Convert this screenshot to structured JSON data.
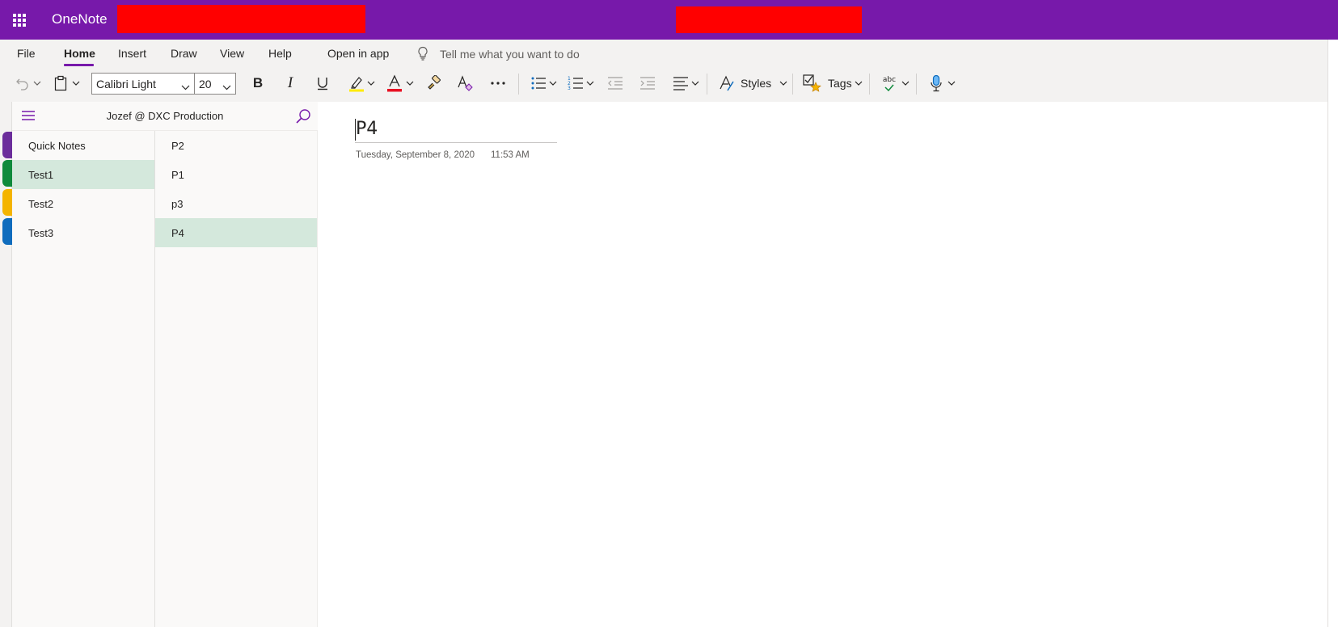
{
  "colors": {
    "brand": "#7719aa",
    "redaction": "#ff0000",
    "selected_background": "#d4e8dc",
    "section_tabs": [
      "#6b2d9b",
      "#0f8a3c",
      "#f4b400",
      "#0f6cbd"
    ]
  },
  "app": {
    "title": "OneNote",
    "launcher_icon": "waffle-grid-icon"
  },
  "ribbon": {
    "tabs": [
      {
        "label": "File"
      },
      {
        "label": "Home",
        "active": true
      },
      {
        "label": "Insert"
      },
      {
        "label": "Draw"
      },
      {
        "label": "View"
      },
      {
        "label": "Help"
      }
    ],
    "open_in_app": "Open in app",
    "tell_me_placeholder": "Tell me what you want to do",
    "font_name": "Calibri Light",
    "font_size": "20",
    "styles_label": "Styles",
    "tags_label": "Tags",
    "spelling_text": "abc",
    "icons": [
      "undo-icon",
      "paste-icon",
      "bold-icon",
      "italic-icon",
      "underline-icon",
      "highlight-icon",
      "font-color-icon",
      "format-painter-icon",
      "clear-formatting-icon",
      "more-icon",
      "bullets-icon",
      "numbering-icon",
      "decrease-indent-icon",
      "increase-indent-icon",
      "align-icon",
      "styles-icon",
      "tags-icon",
      "spelling-icon",
      "dictate-icon"
    ]
  },
  "nav": {
    "notebook_name": "Jozef @ DXC Production",
    "sections": [
      {
        "label": "Quick Notes",
        "active": false
      },
      {
        "label": "Test1",
        "active": true
      },
      {
        "label": "Test2",
        "active": false
      },
      {
        "label": "Test3",
        "active": false
      }
    ],
    "pages": [
      {
        "label": "P2",
        "active": false
      },
      {
        "label": "P1",
        "active": false
      },
      {
        "label": "p3",
        "active": false
      },
      {
        "label": "P4",
        "active": true
      }
    ]
  },
  "page": {
    "title": "P4",
    "date": "Tuesday, September 8, 2020",
    "time": "11:53 AM"
  }
}
